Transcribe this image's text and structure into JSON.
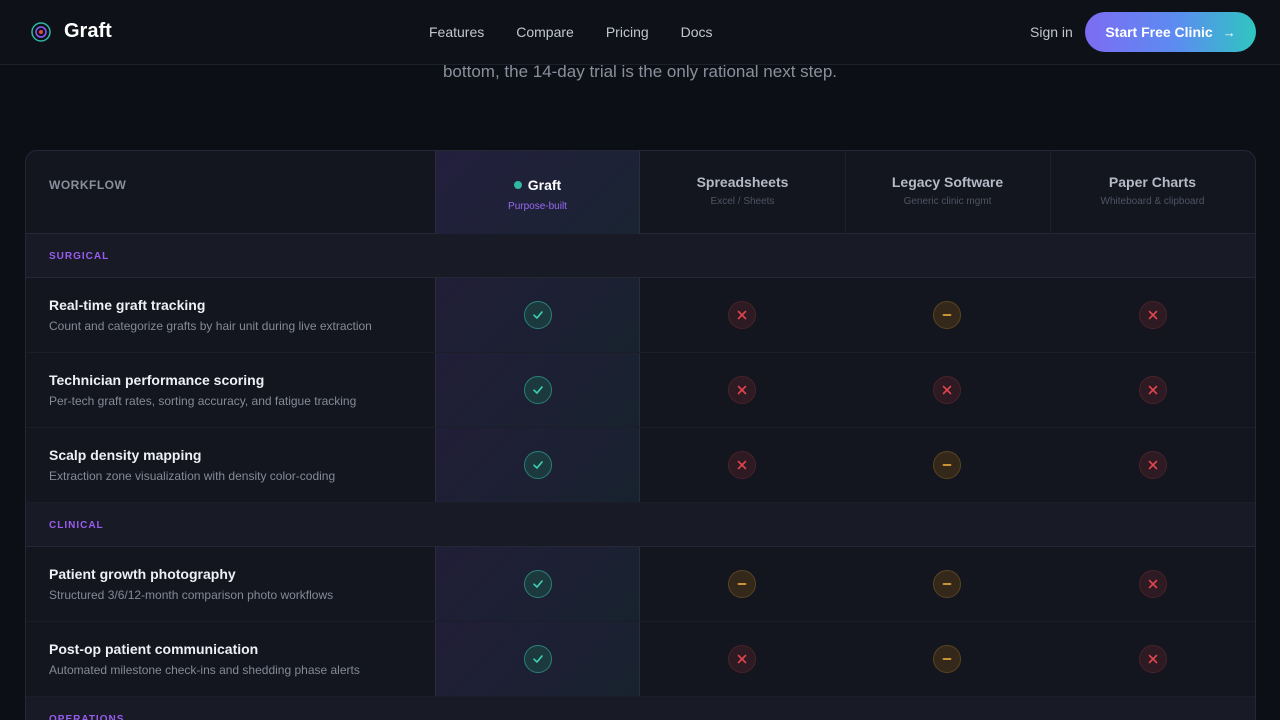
{
  "nav": {
    "brand": "Graft",
    "links": [
      "Features",
      "Compare",
      "Pricing",
      "Docs"
    ],
    "signin": "Sign in",
    "cta": "Start Free Clinic",
    "brand_color": "#7c6cf3"
  },
  "subtitle": "bottom, the 14-day trial is the only rational next step.",
  "table": {
    "workflow_label": "WORKFLOW",
    "columns": [
      {
        "title": "Graft",
        "sub": "Purpose-built"
      },
      {
        "title": "Spreadsheets",
        "sub": "Excel / Sheets"
      },
      {
        "title": "Legacy Software",
        "sub": "Generic clinic mgmt"
      },
      {
        "title": "Paper Charts",
        "sub": "Whiteboard & clipboard"
      }
    ],
    "sections": [
      {
        "label": "SURGICAL",
        "rows": [
          {
            "title": "Real-time graft tracking",
            "desc": "Count and categorize grafts by hair unit during live extraction",
            "marks": [
              "yes",
              "no",
              "partial",
              "no"
            ]
          },
          {
            "title": "Technician performance scoring",
            "desc": "Per-tech graft rates, sorting accuracy, and fatigue tracking",
            "marks": [
              "yes",
              "no",
              "no",
              "no"
            ]
          },
          {
            "title": "Scalp density mapping",
            "desc": "Extraction zone visualization with density color-coding",
            "marks": [
              "yes",
              "no",
              "partial",
              "no"
            ]
          }
        ]
      },
      {
        "label": "CLINICAL",
        "rows": [
          {
            "title": "Patient growth photography",
            "desc": "Structured 3/6/12-month comparison photo workflows",
            "marks": [
              "yes",
              "partial",
              "partial",
              "no"
            ]
          },
          {
            "title": "Post-op patient communication",
            "desc": "Automated milestone check-ins and shedding phase alerts",
            "marks": [
              "yes",
              "no",
              "partial",
              "no"
            ]
          }
        ]
      },
      {
        "label": "OPERATIONS",
        "rows": []
      }
    ],
    "colors": {
      "yes": "#3fd1b8",
      "no": "#e0454f",
      "partial": "#e0a23a"
    }
  }
}
